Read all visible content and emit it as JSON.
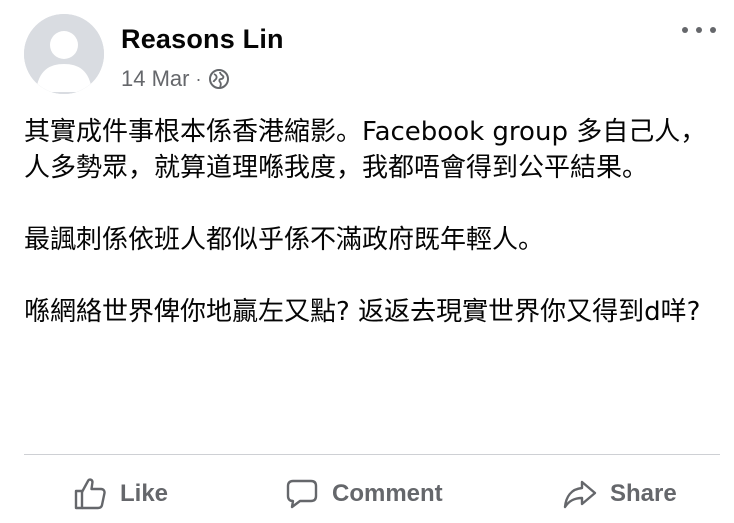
{
  "post": {
    "author": "Reasons Lin",
    "date": "14 Mar",
    "separator": "·",
    "privacy_icon": "globe-icon",
    "more_icon": "more-options-icon",
    "paragraphs": [
      "其實成件事根本係香港縮影。Facebook group 多自己人，人多勢眾，就算道理喺我度，我都唔會得到公平結果。",
      "最諷刺係依班人都似乎係不滿政府既年輕人。",
      "喺網絡世界俾你地贏左又點? 返返去現實世界你又得到d咩?"
    ]
  },
  "actions": {
    "like_label": "Like",
    "comment_label": "Comment",
    "share_label": "Share"
  },
  "colors": {
    "text": "#050505",
    "secondary": "#65676b",
    "divider": "#ced0d4",
    "avatar_bg": "#d9dce1",
    "avatar_fg": "#ffffff"
  }
}
